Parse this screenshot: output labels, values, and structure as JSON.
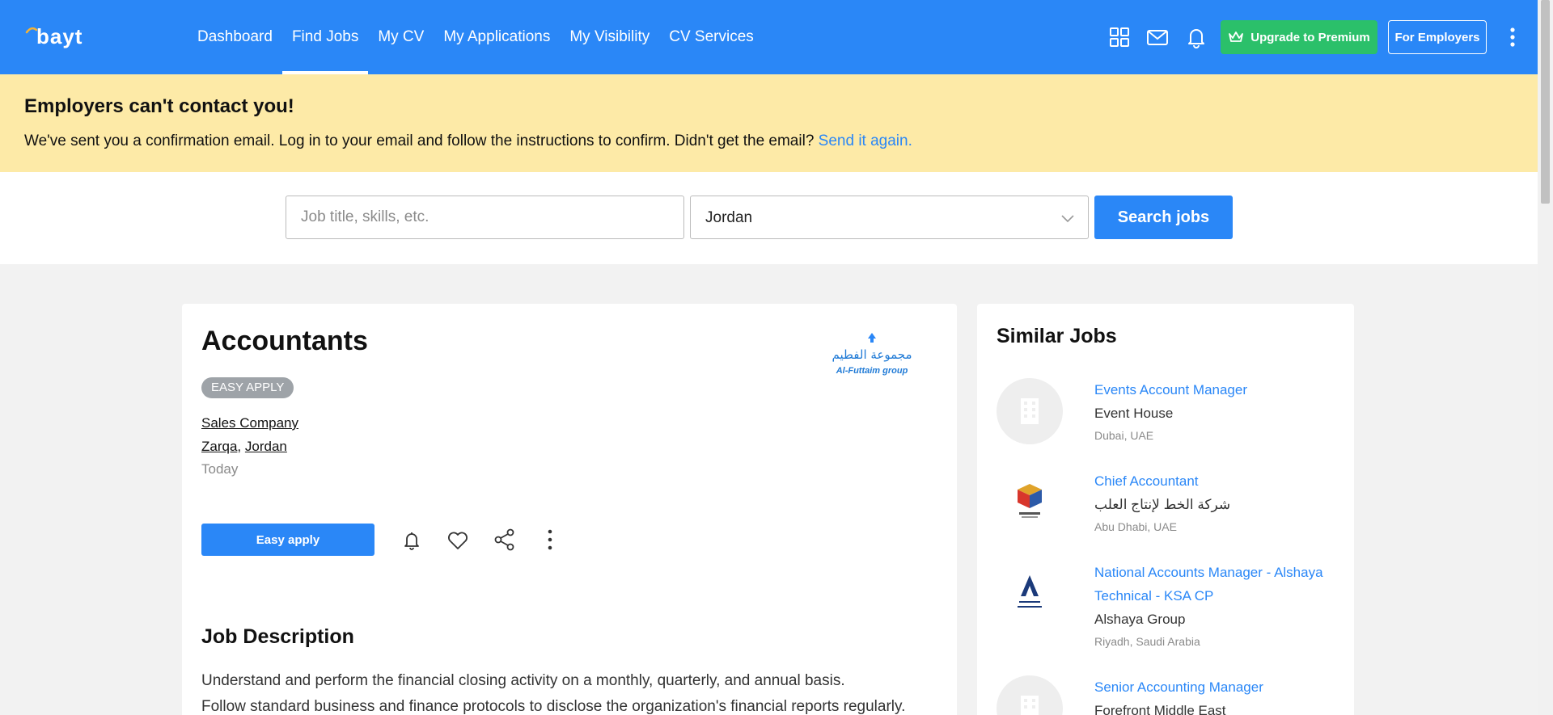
{
  "header": {
    "logo_text": "bayt",
    "nav": [
      {
        "label": "Dashboard"
      },
      {
        "label": "Find Jobs",
        "active": true
      },
      {
        "label": "My CV"
      },
      {
        "label": "My Applications"
      },
      {
        "label": "My Visibility"
      },
      {
        "label": "CV Services"
      }
    ],
    "icons": [
      "apps-grid-icon",
      "mail-icon",
      "bell-icon",
      "more-vertical-icon"
    ],
    "premium_label": "Upgrade to Premium",
    "employers_label": "For Employers"
  },
  "banner": {
    "title": "Employers can't contact you!",
    "text": "We've sent you a confirmation email. Log in to your email and follow the instructions to confirm. Didn't get the email?",
    "link": "Send it again."
  },
  "search": {
    "placeholder": "Job title, skills, etc.",
    "query": "",
    "location": "Jordan",
    "button_label": "Search jobs"
  },
  "job": {
    "title": "Accountants",
    "badge": "EASY APPLY",
    "company": "Sales Company",
    "city": "Zarqa",
    "separator": ",",
    "country": "Jordan",
    "posted": "Today",
    "company_logo_text": "Al-Futtaim group",
    "apply_label": "Easy apply",
    "actions": [
      "bell-icon",
      "heart-icon",
      "share-icon",
      "more-vertical-icon"
    ],
    "description_title": "Job Description",
    "description_lines": [
      "Understand and perform the financial closing activity on a monthly, quarterly, and annual basis.",
      "Follow standard business and finance protocols to disclose the organization's financial reports regularly."
    ]
  },
  "similar": {
    "title": "Similar Jobs",
    "items": [
      {
        "title": "Events Account Manager",
        "company": "Event House",
        "location": "Dubai, UAE",
        "logo": "building-placeholder-icon"
      },
      {
        "title": "Chief Accountant",
        "company": "شركة الخط لإنتاج العلب",
        "location": "Abu Dhabi, UAE",
        "logo": "cube-logo"
      },
      {
        "title": "National Accounts Manager - Alshaya Technical - KSA CP",
        "company": "Alshaya Group",
        "location": "Riyadh, Saudi Arabia",
        "logo": "alshaya-logo"
      },
      {
        "title": "Senior Accounting Manager",
        "company": "Forefront Middle East",
        "location": "",
        "logo": "building-placeholder-icon"
      }
    ]
  },
  "colors": {
    "brand_blue": "#2a87f7",
    "premium_green": "#2bc06a",
    "banner_yellow": "#fdeaa7"
  }
}
